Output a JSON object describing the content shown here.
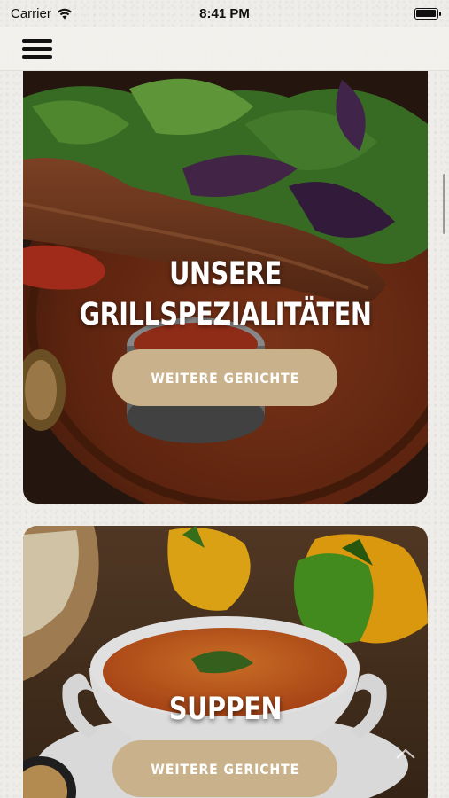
{
  "status_bar": {
    "carrier": "Carrier",
    "time": "8:41 PM",
    "wifi_icon": "wifi-icon",
    "battery_icon": "battery-icon",
    "battery_level": 1.0
  },
  "nav": {
    "menu_icon": "hamburger-menu-icon"
  },
  "categories": [
    {
      "title_line1": "UNSERE",
      "title_line2": "GRILLSPEZIALITÄTEN",
      "button_label": "WEITERE GERICHTE"
    },
    {
      "title_line1": "SUPPEN",
      "button_label": "WEITERE GERICHTE"
    }
  ],
  "colors": {
    "accent_button": "#c9b18b",
    "background": "#efede9"
  },
  "scroll_top_icon": "chevron-up-icon"
}
